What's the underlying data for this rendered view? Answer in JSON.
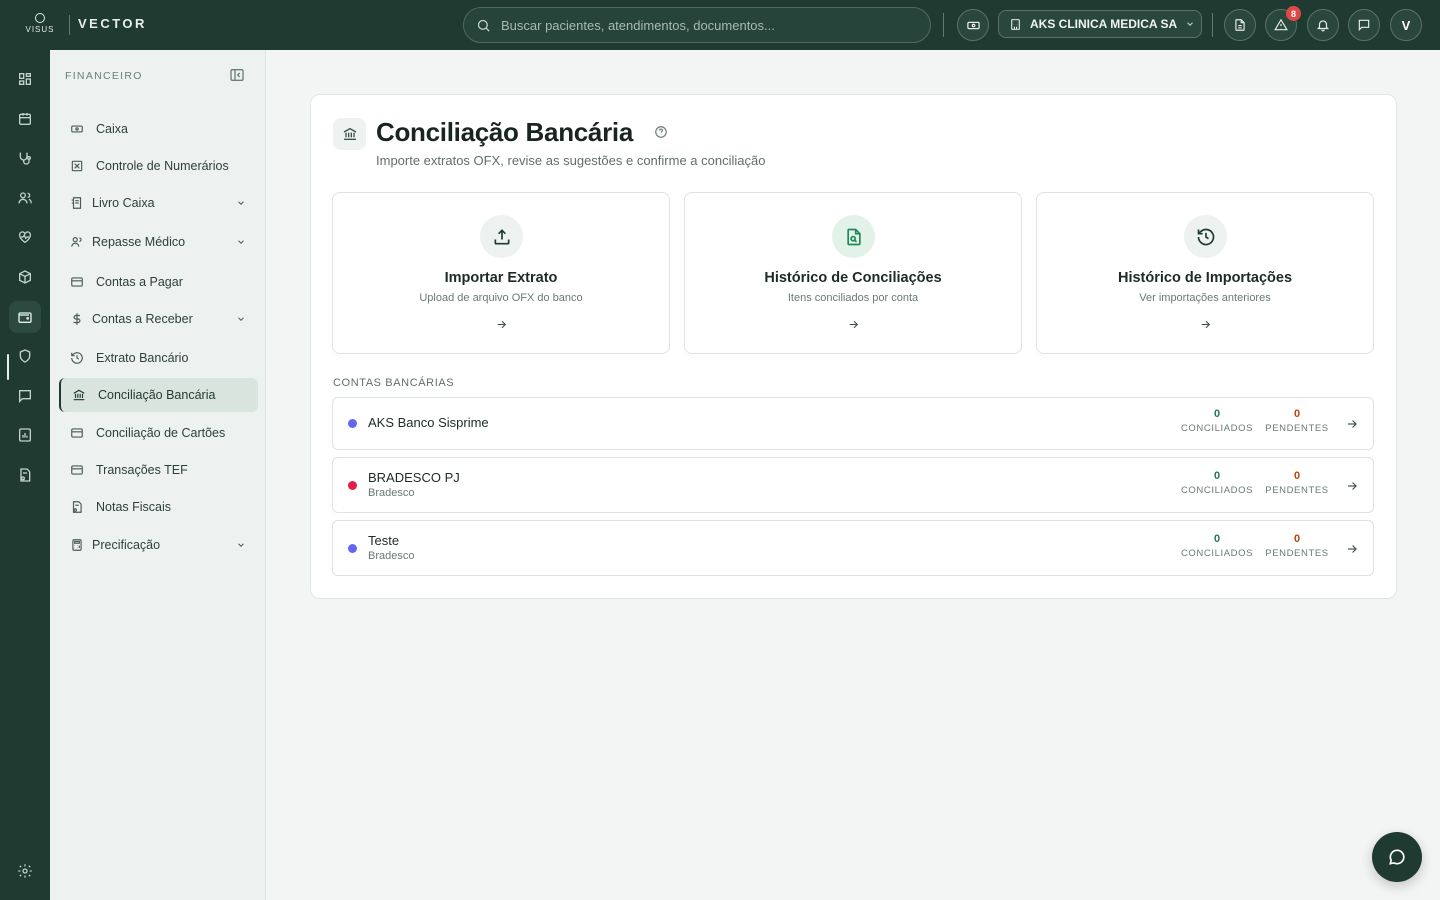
{
  "topbar": {
    "logo_text": "VISUS",
    "brand": "VECTOR",
    "search_placeholder": "Buscar pacientes, atendimentos, documentos...",
    "company": "AKS CLINICA MEDICA SA",
    "alerts_count": "8",
    "avatar_initial": "V"
  },
  "sidebar": {
    "title": "FINANCEIRO",
    "items": [
      {
        "label": "Caixa",
        "icon": "cash-icon"
      },
      {
        "label": "Controle de Numerários",
        "icon": "numerarios-icon"
      },
      {
        "label": "Livro Caixa",
        "icon": "ledger-icon",
        "expandable": true
      },
      {
        "label": "Repasse Médico",
        "icon": "users-icon",
        "expandable": true
      },
      {
        "label": "Contas a Pagar",
        "icon": "card-icon"
      },
      {
        "label": "Contas a Receber",
        "icon": "dollar-icon",
        "expandable": true
      },
      {
        "label": "Extrato Bancário",
        "icon": "history-icon"
      },
      {
        "label": "Conciliação Bancária",
        "icon": "bank-icon",
        "active": true
      },
      {
        "label": "Conciliação de Cartões",
        "icon": "card-icon"
      },
      {
        "label": "Transações TEF",
        "icon": "card-icon"
      },
      {
        "label": "Notas Fiscais",
        "icon": "invoice-icon"
      },
      {
        "label": "Precificação",
        "icon": "calculator-icon",
        "expandable": true
      }
    ]
  },
  "page": {
    "title": "Conciliação Bancária",
    "subtitle": "Importe extratos OFX, revise as sugestões e confirme a conciliação"
  },
  "actions": [
    {
      "title": "Importar Extrato",
      "subtitle": "Upload de arquivo OFX do banco",
      "icon": "upload-icon"
    },
    {
      "title": "Histórico de Conciliações",
      "subtitle": "Itens conciliados por conta",
      "icon": "file-search-icon"
    },
    {
      "title": "Histórico de Importações",
      "subtitle": "Ver importações anteriores",
      "icon": "history-icon"
    }
  ],
  "accounts_section": {
    "label": "CONTAS BANCÁRIAS",
    "conciliados_label": "CONCILIADOS",
    "pendentes_label": "PENDENTES",
    "accounts": [
      {
        "name": "AKS Banco Sisprime",
        "bank": "",
        "dot_color": "#6366f1",
        "conciliados": "0",
        "pendentes": "0"
      },
      {
        "name": "BRADESCO PJ",
        "bank": "Bradesco",
        "dot_color": "#e11d48",
        "conciliados": "0",
        "pendentes": "0"
      },
      {
        "name": "Teste",
        "bank": "Bradesco",
        "dot_color": "#6366f1",
        "conciliados": "0",
        "pendentes": "0"
      }
    ]
  },
  "colors": {
    "primary_dark": "#1f3a31",
    "conciliados": "#1f7a5a",
    "pendentes": "#c2410c"
  }
}
